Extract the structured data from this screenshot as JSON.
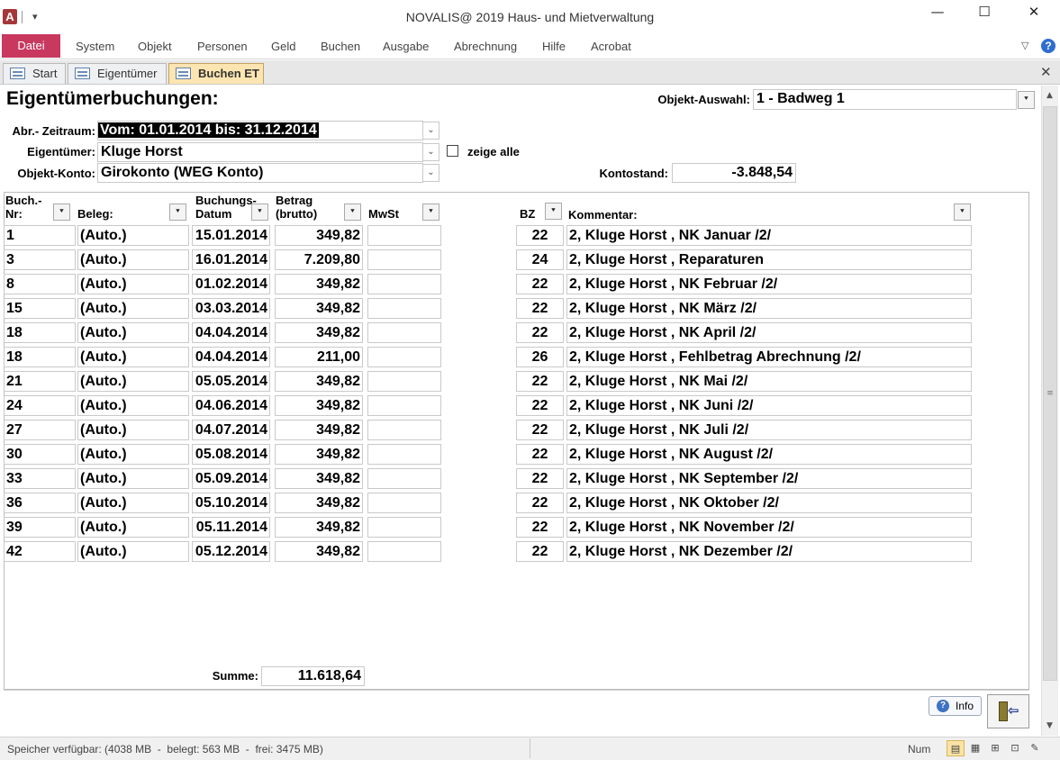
{
  "window": {
    "app_logo": "A",
    "title": "NOVALIS@ 2019 Haus- und Mietverwaltung",
    "qat_arrow": "▾",
    "minimize": "—",
    "maximize": "☐",
    "close": "✕"
  },
  "menu": {
    "file": "Datei",
    "items": [
      "System",
      "Objekt",
      "Personen",
      "Geld",
      "Buchen",
      "Ausgabe",
      "Abrechnung",
      "Hilfe",
      "Acrobat"
    ],
    "collapse": "▽",
    "help": "?"
  },
  "doc_tabs": {
    "tabs": [
      "Start",
      "Eigentümer",
      "Buchen ET"
    ],
    "active_index": 2,
    "close": "✕"
  },
  "form": {
    "title": "Eigentümerbuchungen:",
    "objekt_auswahl_label": "Objekt-Auswahl:",
    "objekt_auswahl_value": "1 - Badweg 1",
    "zeitraum_label": "Abr.- Zeitraum:",
    "zeitraum_value": "Vom:  01.01.2014  bis:  31.12.2014",
    "eigentuemer_label": "Eigentümer:",
    "eigentuemer_value": "Kluge  Horst",
    "zeige_alle_label": "zeige alle",
    "zeige_alle_checked": false,
    "konto_label": "Objekt-Konto:",
    "konto_value": "Girokonto (WEG Konto)",
    "kontostand_label": "Kontostand:",
    "kontostand_value": "-3.848,54",
    "dropdown_glyph": "⌄",
    "sort_glyph": "⯆"
  },
  "table": {
    "headers": {
      "nr": [
        "Buch.-",
        "Nr:"
      ],
      "beleg": "Beleg:",
      "datum": [
        "Buchungs-",
        "Datum"
      ],
      "betrag": [
        "Betrag",
        "(brutto)"
      ],
      "mwst": "MwSt",
      "bz": "BZ",
      "kommentar": "Kommentar:"
    },
    "rows": [
      {
        "nr": "1",
        "beleg": "(Auto.)",
        "datum": "15.01.2014",
        "betrag": "349,82",
        "mwst": "",
        "bz": "22",
        "kommentar": "2, Kluge Horst , NK Januar /2/"
      },
      {
        "nr": "3",
        "beleg": "(Auto.)",
        "datum": "16.01.2014",
        "betrag": "7.209,80",
        "mwst": "",
        "bz": "24",
        "kommentar": "2, Kluge Horst , Reparaturen"
      },
      {
        "nr": "8",
        "beleg": "(Auto.)",
        "datum": "01.02.2014",
        "betrag": "349,82",
        "mwst": "",
        "bz": "22",
        "kommentar": "2, Kluge Horst , NK Februar /2/"
      },
      {
        "nr": "15",
        "beleg": "(Auto.)",
        "datum": "03.03.2014",
        "betrag": "349,82",
        "mwst": "",
        "bz": "22",
        "kommentar": "2, Kluge Horst , NK März /2/"
      },
      {
        "nr": "18",
        "beleg": "(Auto.)",
        "datum": "04.04.2014",
        "betrag": "349,82",
        "mwst": "",
        "bz": "22",
        "kommentar": "2, Kluge Horst , NK April /2/"
      },
      {
        "nr": "18",
        "beleg": "(Auto.)",
        "datum": "04.04.2014",
        "betrag": "211,00",
        "mwst": "",
        "bz": "26",
        "kommentar": "2, Kluge Horst , Fehlbetrag Abrechnung /2/"
      },
      {
        "nr": "21",
        "beleg": "(Auto.)",
        "datum": "05.05.2014",
        "betrag": "349,82",
        "mwst": "",
        "bz": "22",
        "kommentar": "2, Kluge Horst , NK Mai /2/"
      },
      {
        "nr": "24",
        "beleg": "(Auto.)",
        "datum": "04.06.2014",
        "betrag": "349,82",
        "mwst": "",
        "bz": "22",
        "kommentar": "2, Kluge Horst , NK Juni /2/"
      },
      {
        "nr": "27",
        "beleg": "(Auto.)",
        "datum": "04.07.2014",
        "betrag": "349,82",
        "mwst": "",
        "bz": "22",
        "kommentar": "2, Kluge Horst , NK Juli /2/"
      },
      {
        "nr": "30",
        "beleg": "(Auto.)",
        "datum": "05.08.2014",
        "betrag": "349,82",
        "mwst": "",
        "bz": "22",
        "kommentar": "2, Kluge Horst , NK August /2/"
      },
      {
        "nr": "33",
        "beleg": "(Auto.)",
        "datum": "05.09.2014",
        "betrag": "349,82",
        "mwst": "",
        "bz": "22",
        "kommentar": "2, Kluge Horst , NK September /2/"
      },
      {
        "nr": "36",
        "beleg": "(Auto.)",
        "datum": "05.10.2014",
        "betrag": "349,82",
        "mwst": "",
        "bz": "22",
        "kommentar": "2, Kluge Horst , NK Oktober /2/"
      },
      {
        "nr": "39",
        "beleg": "(Auto.)",
        "datum": "05.11.2014",
        "betrag": "349,82",
        "mwst": "",
        "bz": "22",
        "kommentar": "2, Kluge Horst , NK November /2/"
      },
      {
        "nr": "42",
        "beleg": "(Auto.)",
        "datum": "05.12.2014",
        "betrag": "349,82",
        "mwst": "",
        "bz": "22",
        "kommentar": "2, Kluge Horst , NK Dezember /2/"
      }
    ],
    "summe_label": "Summe:",
    "summe_value": "11.618,64"
  },
  "buttons": {
    "info_label": "Info",
    "info_icon": "?",
    "exit_arrow": "⇦"
  },
  "scrollbar": {
    "up": "▲",
    "down": "▼",
    "grip": "≡"
  },
  "status": {
    "memory": "Speicher verfügbar: (4038 MB  -  belegt: 563 MB  -  frei: 3475 MB)",
    "num": "Num",
    "view_icons": [
      "▤",
      "▦",
      "⊞",
      "⊡",
      "✎"
    ]
  },
  "colors": {
    "file_tab": "#c8385f",
    "active_doc_tab": "#fde5b1",
    "help_icon": "#2f6ecf"
  }
}
